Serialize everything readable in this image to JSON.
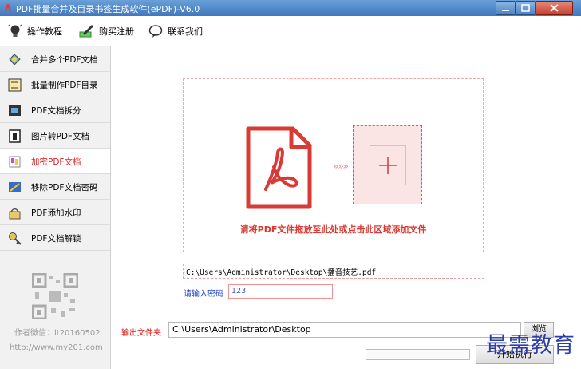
{
  "window": {
    "title": "PDF批量合并及目录书签生成软件(ePDF)-V6.0"
  },
  "toolbar": {
    "help": "操作教程",
    "buy": "购买注册",
    "contact": "联系我们"
  },
  "sidebar": {
    "items": [
      {
        "label": "合并多个PDF文档",
        "icon": "merge-icon"
      },
      {
        "label": "批量制作PDF目录",
        "icon": "toc-icon"
      },
      {
        "label": "PDF文档拆分",
        "icon": "split-icon"
      },
      {
        "label": "图片转PDF文档",
        "icon": "image-to-pdf-icon"
      },
      {
        "label": "加密PDF文档",
        "icon": "encrypt-icon",
        "active": true
      },
      {
        "label": "移除PDF文档密码",
        "icon": "remove-password-icon"
      },
      {
        "label": "PDF添加水印",
        "icon": "watermark-icon"
      },
      {
        "label": "PDF文档解锁",
        "icon": "unlock-icon"
      }
    ],
    "author": "作者微信：lt20160502",
    "url": "http://www.my201.com"
  },
  "dropzone": {
    "hint": "请将PDF文件拖放至此处或点击此区域添加文件",
    "arrows": "»»»"
  },
  "file": {
    "path": "C:\\Users\\Administrator\\Desktop\\播音技艺.pdf"
  },
  "password": {
    "label": "请输入密码",
    "value": "123"
  },
  "output": {
    "label": "输出文件夹",
    "value": "C:\\Users\\Administrator\\Desktop",
    "browse": "浏览"
  },
  "actions": {
    "start": "开始执行"
  },
  "watermark": "最需教育",
  "colors": {
    "accent": "#d93a33",
    "titlebar": "#4a86c8",
    "link": "#2244cc"
  }
}
